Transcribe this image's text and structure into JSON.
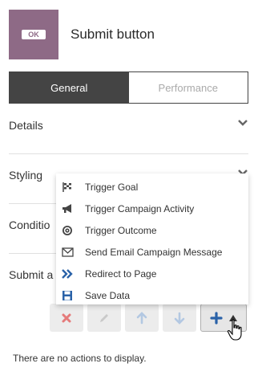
{
  "header": {
    "thumb_label": "OK",
    "title": "Submit button"
  },
  "tabs": [
    {
      "label": "General"
    },
    {
      "label": "Performance"
    }
  ],
  "sections": [
    {
      "label": "Details"
    },
    {
      "label": "Styling"
    },
    {
      "label": "Conditio"
    },
    {
      "label": "Submit a"
    }
  ],
  "menu": {
    "items": [
      {
        "label": "Trigger Goal",
        "icon": "goal-flag-icon"
      },
      {
        "label": "Trigger Campaign Activity",
        "icon": "megaphone-icon"
      },
      {
        "label": "Trigger Outcome",
        "icon": "target-icon"
      },
      {
        "label": "Send Email Campaign Message",
        "icon": "envelope-icon"
      },
      {
        "label": "Redirect to Page",
        "icon": "double-chevron-right-icon"
      },
      {
        "label": "Save Data",
        "icon": "floppy-disk-icon"
      }
    ]
  },
  "empty_message": "There are no actions to display.",
  "colors": {
    "thumb": "#8e6a86",
    "tab_active": "#444444",
    "accent_blue": "#2a62a8",
    "delete_red": "#e57b7b"
  }
}
